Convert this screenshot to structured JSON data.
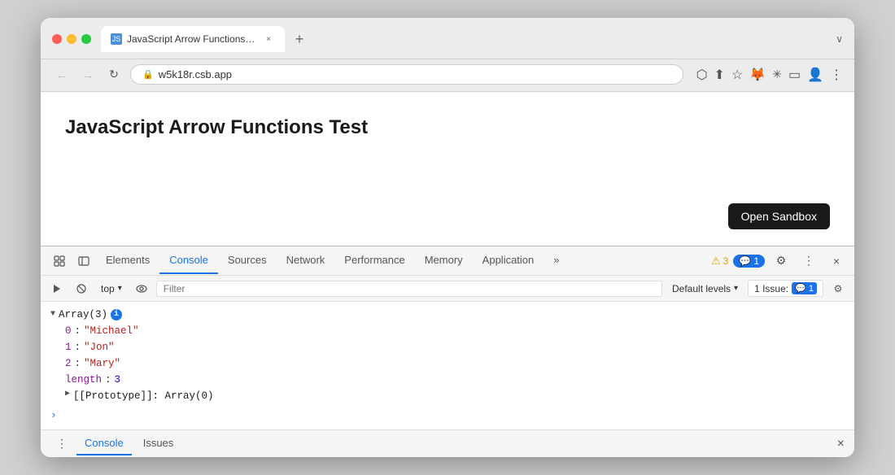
{
  "browser": {
    "traffic_lights": [
      "red",
      "yellow",
      "green"
    ],
    "tab": {
      "title": "JavaScript Arrow Functions Te...",
      "close_label": "×",
      "new_tab_label": "+"
    },
    "chevron": "∨",
    "address": {
      "back_label": "←",
      "forward_label": "→",
      "refresh_label": "↻",
      "url": "w5k18r.csb.app",
      "lock_icon": "🔒",
      "cast_icon": "⬡",
      "star_icon": "☆",
      "ext1": "🦊",
      "ext2": "✳",
      "sidebar_icon": "▭",
      "profile_icon": "👤",
      "menu_icon": "⋮"
    }
  },
  "page": {
    "title": "JavaScript Arrow Functions Test",
    "open_sandbox_label": "Open Sandbox"
  },
  "devtools": {
    "panel_icon_1": "⛶",
    "panel_icon_2": "⧉",
    "tabs": [
      {
        "id": "elements",
        "label": "Elements",
        "active": false
      },
      {
        "id": "console",
        "label": "Console",
        "active": true
      },
      {
        "id": "sources",
        "label": "Sources",
        "active": false
      },
      {
        "id": "network",
        "label": "Network",
        "active": false
      },
      {
        "id": "performance",
        "label": "Performance",
        "active": false
      },
      {
        "id": "memory",
        "label": "Memory",
        "active": false
      },
      {
        "id": "application",
        "label": "Application",
        "active": false
      },
      {
        "id": "more",
        "label": "»",
        "active": false
      }
    ],
    "warning_count": "3",
    "info_count": "1",
    "settings_icon": "⚙",
    "more_icon": "⋮",
    "close_icon": "×"
  },
  "console": {
    "play_icon": "▶",
    "block_icon": "⊘",
    "top_label": "top",
    "dropdown_icon": "▾",
    "eye_icon": "👁",
    "filter_placeholder": "Filter",
    "default_levels_label": "Default levels",
    "issue_label": "1 Issue:",
    "issue_count": "1",
    "settings_icon": "⚙",
    "output": {
      "arrow": "▼",
      "array_label": "Array(3)",
      "items": [
        {
          "index": "0",
          "value": "\"Michael\""
        },
        {
          "index": "1",
          "value": "\"Jon\""
        },
        {
          "index": "2",
          "value": "\"Mary\""
        }
      ],
      "length_key": "length",
      "length_val": "3",
      "proto_label": "[[Prototype]]: Array(0)",
      "proto_arrow": "▶"
    }
  },
  "bottom_bar": {
    "more_icon": "⋮",
    "tabs": [
      {
        "id": "console-bottom",
        "label": "Console",
        "active": true
      },
      {
        "id": "issues-bottom",
        "label": "Issues",
        "active": false
      }
    ],
    "close_icon": "×"
  }
}
